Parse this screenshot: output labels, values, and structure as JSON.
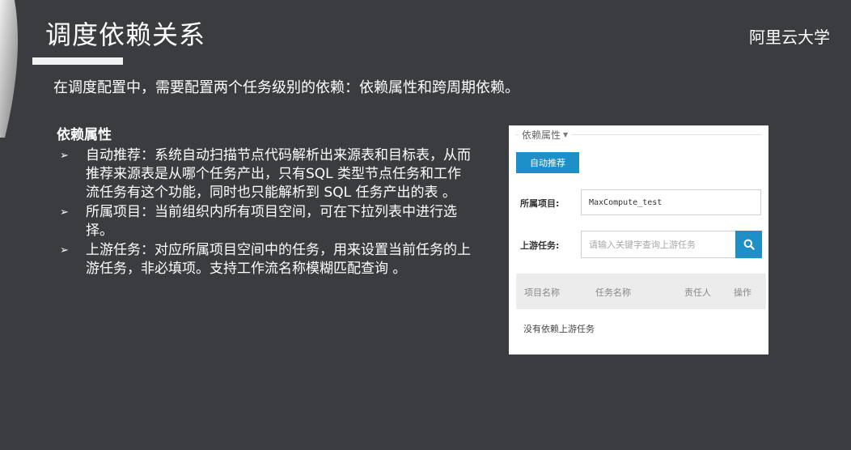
{
  "slide": {
    "title": "调度依赖关系",
    "brand": "阿里云大学",
    "intro": "在调度配置中，需要配置两个任务级别的依赖：依赖属性和跨周期依赖。"
  },
  "section": {
    "heading": "依赖属性",
    "bullet_marker": "➢",
    "bullets": [
      "自动推荐：系统自动扫描节点代码解析出来源表和目标表，从而推荐来源表是从哪个任务产出，只有SQL 类型节点任务和工作流任务有这个功能，同时也只能解析到 SQL 任务产出的表 。",
      "所属项目：当前组织内所有项目空间，可在下拉列表中进行选择。",
      "上游任务：对应所属项目空间中的任务，用来设置当前任务的上游任务，非必填项。支持工作流名称模糊匹配查询 。"
    ]
  },
  "panel": {
    "legend": "依赖属性",
    "auto_recommend_label": "自动推荐",
    "project_label": "所属项目:",
    "project_value": "MaxCompute_test",
    "upstream_label": "上游任务:",
    "upstream_placeholder": "请输入关键字查询上游任务",
    "table_headers": [
      "项目名称",
      "任务名称",
      "责任人",
      "操作"
    ],
    "empty_text": "没有依赖上游任务"
  },
  "icons": {
    "search": "search-icon",
    "legend_caret": "caret-down-icon",
    "bullet": "bullet-arrow-icon"
  },
  "colors": {
    "background": "#3a3c40",
    "accent_blue": "#1e90c8"
  }
}
